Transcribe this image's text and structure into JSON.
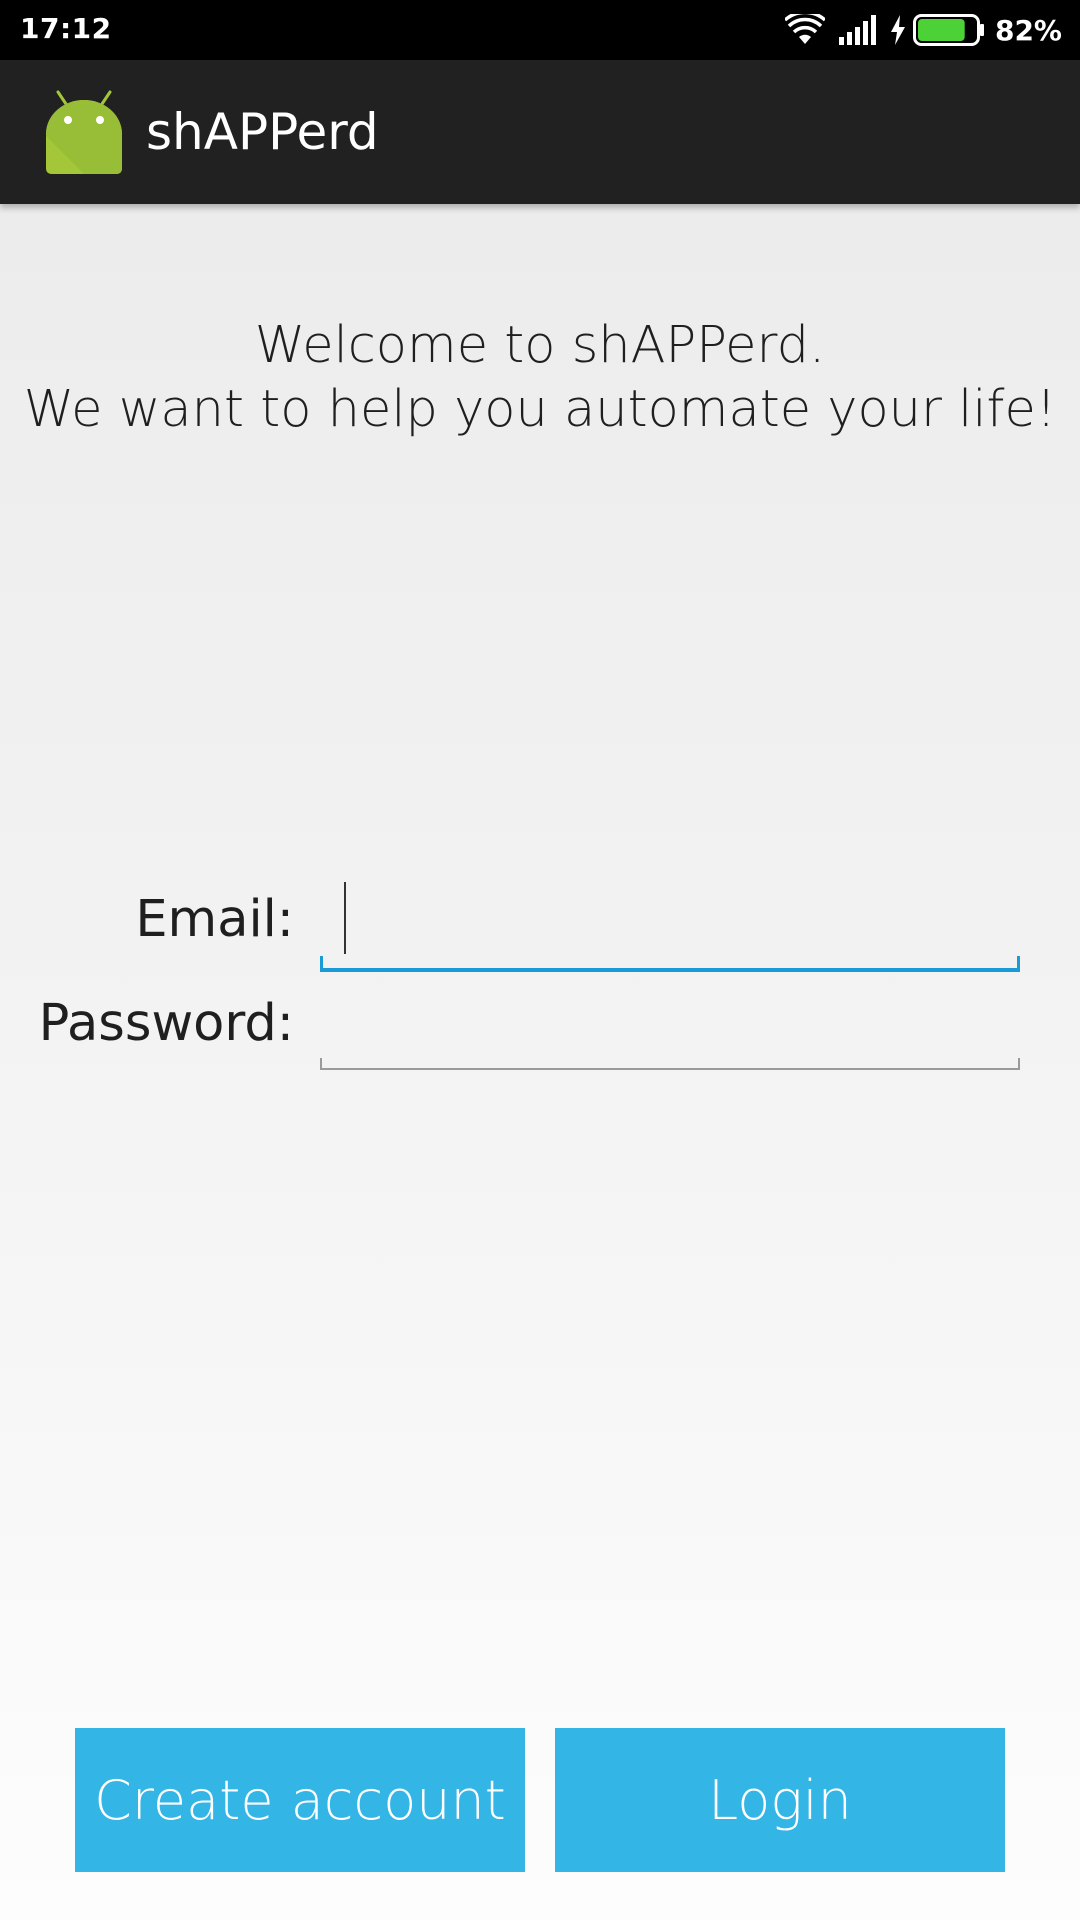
{
  "status_bar": {
    "time": "17:12",
    "battery_percent": "82%",
    "battery_level": 0.82,
    "icons": [
      "wifi-icon",
      "signal-icon",
      "charging-icon",
      "battery-icon"
    ],
    "battery_fill_color": "#4cd137"
  },
  "action_bar": {
    "app_icon": "android-icon",
    "title": "shAPPerd",
    "background_color": "#212121"
  },
  "welcome": {
    "line1": "Welcome to shAPPerd.",
    "line2": "We want to help you automate your life!"
  },
  "form": {
    "email_label": "Email:",
    "email_value": "",
    "password_label": "Password:",
    "password_value": "",
    "focus_color": "#1a9ad6"
  },
  "buttons": {
    "create_account": "Create account",
    "login": "Login",
    "color": "#33b5e5"
  }
}
